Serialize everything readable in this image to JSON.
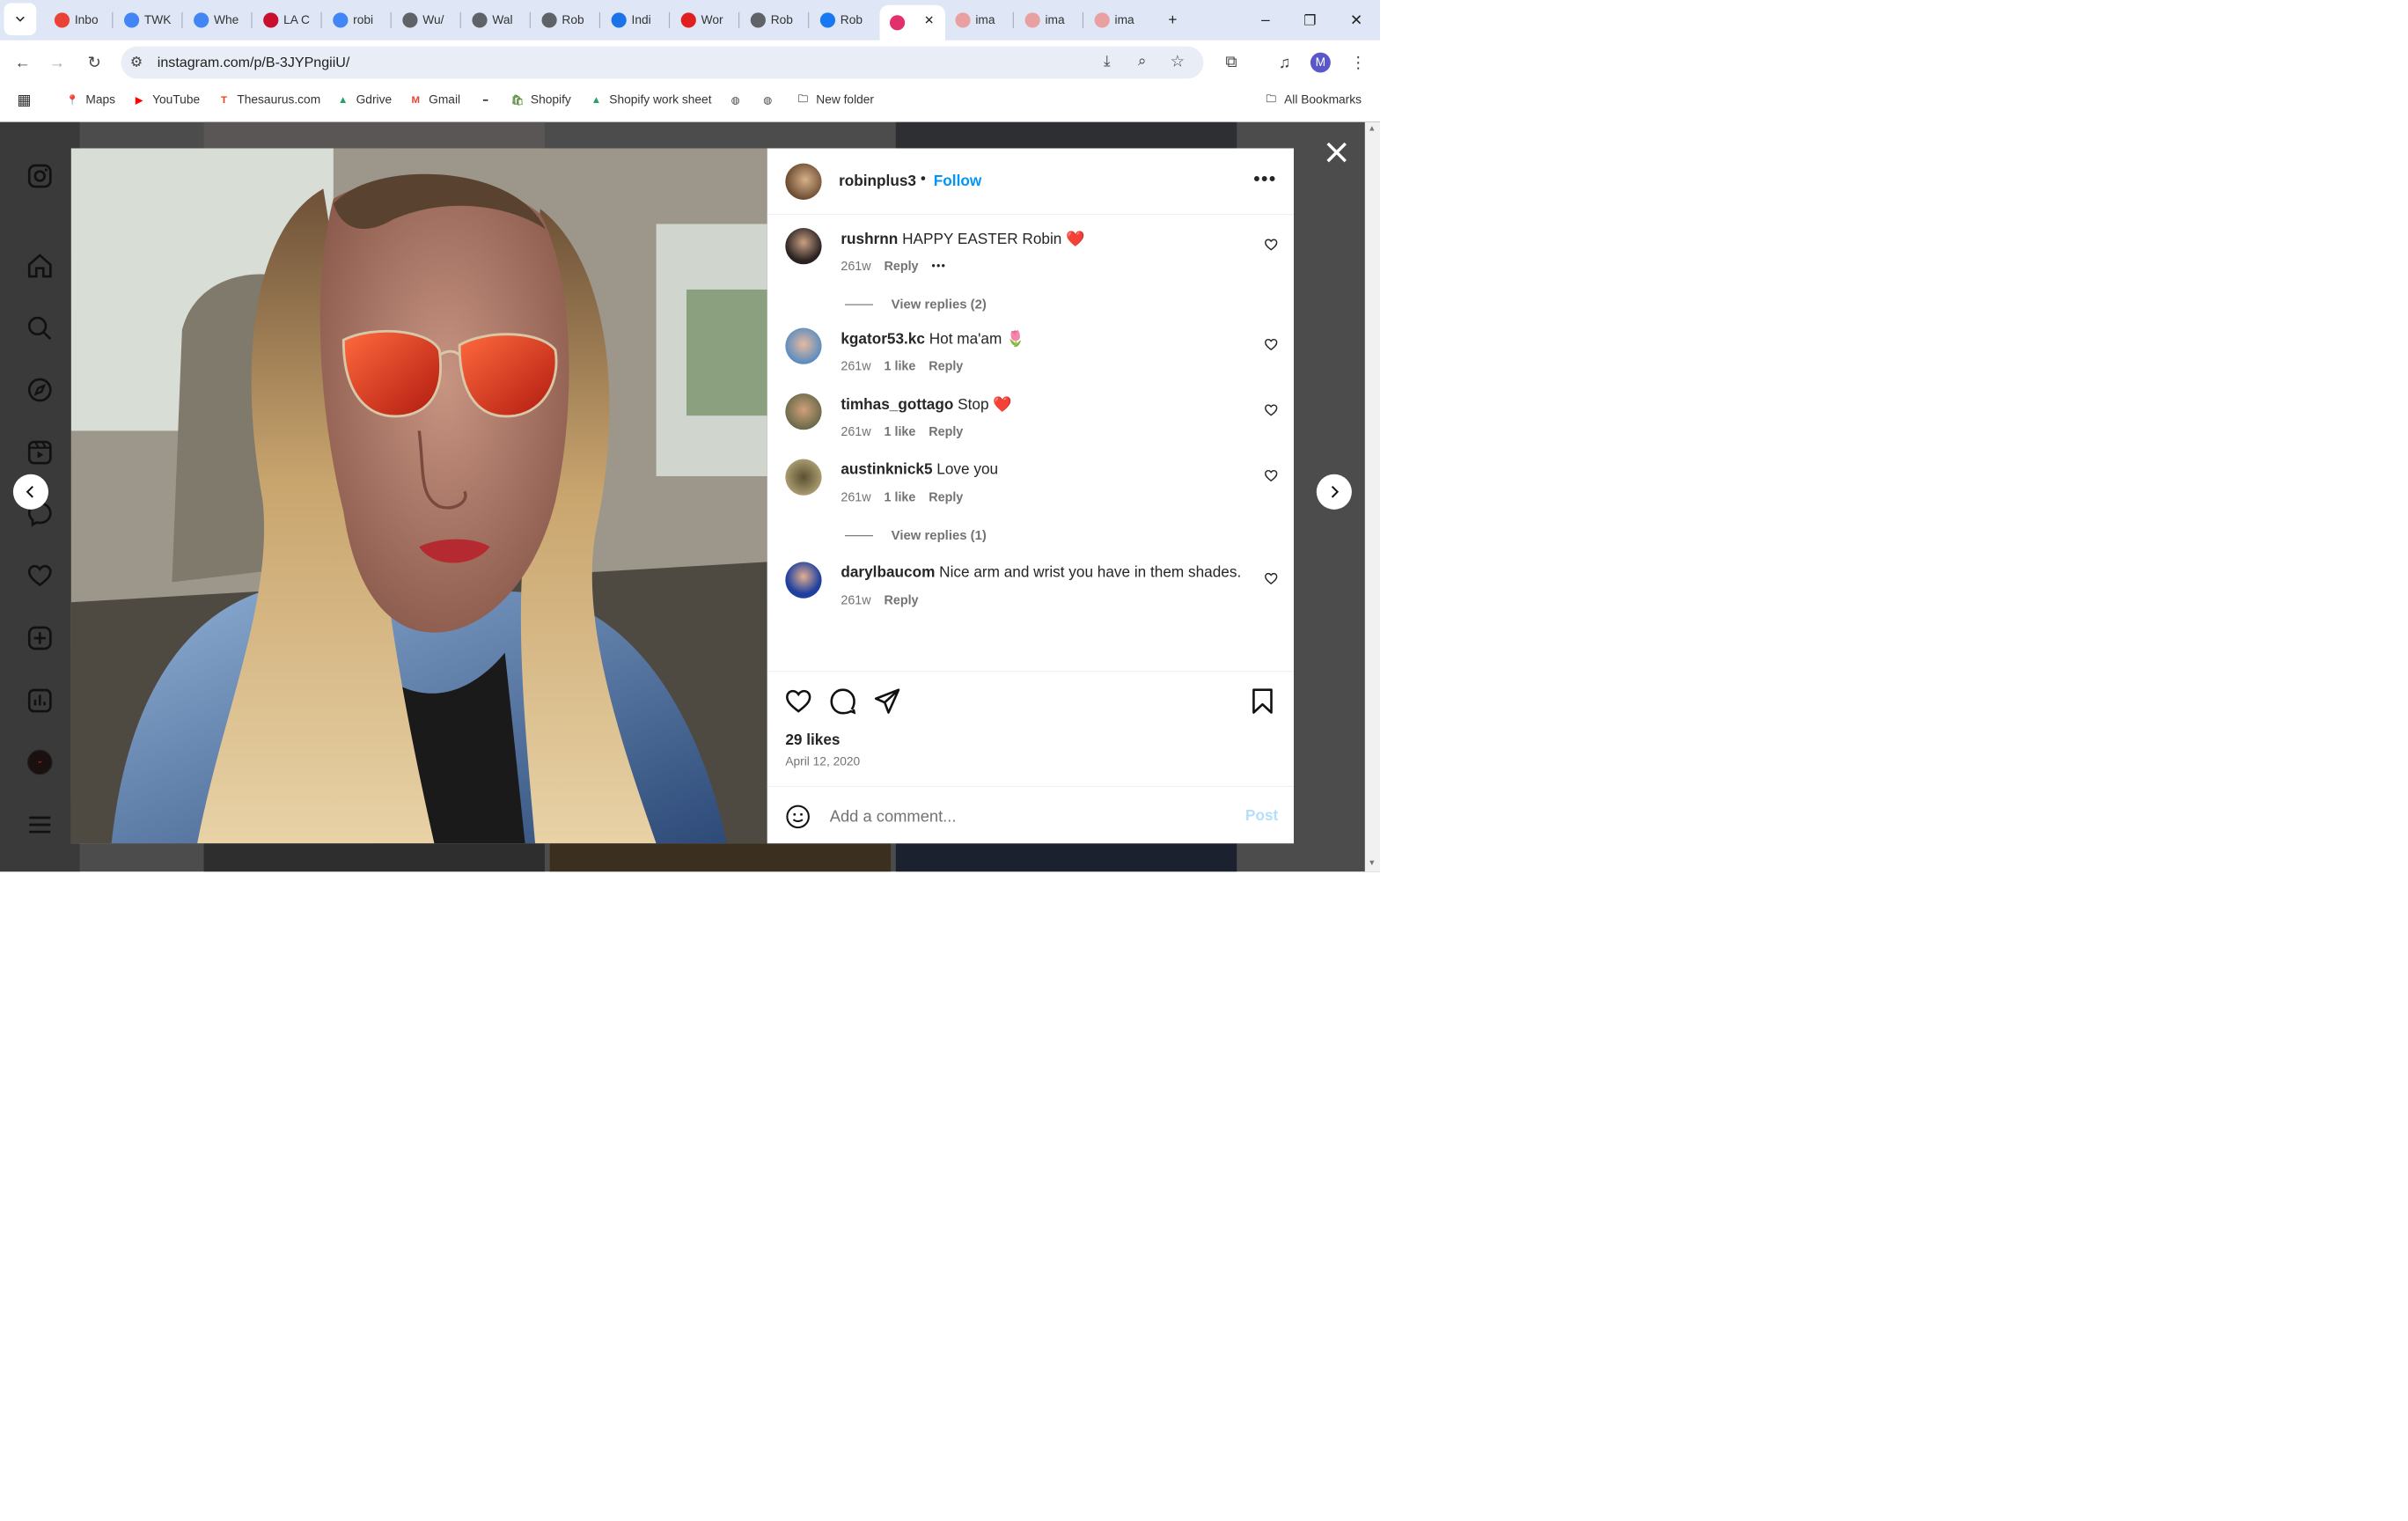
{
  "browser": {
    "tabs": [
      {
        "label": "Inbo",
        "icon": "gmail-icon",
        "color": "#ea4335"
      },
      {
        "label": "TWK",
        "icon": "docs-icon",
        "color": "#4285f4"
      },
      {
        "label": "Whe",
        "icon": "docs-icon",
        "color": "#4285f4"
      },
      {
        "label": "LA C",
        "icon": "nba-icon",
        "color": "#c8102e"
      },
      {
        "label": "robi",
        "icon": "google-icon",
        "color": "#4285f4"
      },
      {
        "label": "Wu/",
        "icon": "globe-icon",
        "color": "#5f6368"
      },
      {
        "label": "Wal",
        "icon": "globe-icon",
        "color": "#5f6368"
      },
      {
        "label": "Rob",
        "icon": "globe-icon",
        "color": "#5f6368"
      },
      {
        "label": "Indi",
        "icon": "search-icon",
        "color": "#1a73e8"
      },
      {
        "label": "Wor",
        "icon": "heart-logo-icon",
        "color": "#e02020"
      },
      {
        "label": "Rob",
        "icon": "globe-icon",
        "color": "#5f6368"
      },
      {
        "label": "Rob",
        "icon": "facebook-icon",
        "color": "#1877f2"
      },
      {
        "label": "",
        "icon": "instagram-icon",
        "color": "#e1306c",
        "active": true
      },
      {
        "label": "ima",
        "icon": "image-icon",
        "color": "#e8a0a0"
      },
      {
        "label": "ima",
        "icon": "image-icon",
        "color": "#e8a0a0"
      },
      {
        "label": "ima",
        "icon": "image-icon",
        "color": "#e8a0a0"
      }
    ],
    "url": "instagram.com/p/B-3JYPngiiU/",
    "profile_initial": "M",
    "bookmarks": [
      {
        "label": "Maps",
        "icon": "maps-icon"
      },
      {
        "label": "YouTube",
        "icon": "youtube-icon"
      },
      {
        "label": "Thesaurus.com",
        "icon": "thesaurus-icon"
      },
      {
        "label": "Gdrive",
        "icon": "gdrive-icon"
      },
      {
        "label": "Gmail",
        "icon": "gmail-icon"
      },
      {
        "label": "",
        "icon": "bbc-icon"
      },
      {
        "label": "Shopify",
        "icon": "shopify-icon"
      },
      {
        "label": "Shopify work sheet",
        "icon": "gdrive-icon"
      },
      {
        "label": "",
        "icon": "globe-icon"
      },
      {
        "label": "",
        "icon": "globe-icon"
      },
      {
        "label": "New folder",
        "icon": "folder-icon"
      }
    ],
    "all_bookmarks": "All Bookmarks"
  },
  "post": {
    "username": "robinplus3",
    "follow": "Follow",
    "likes": "29 likes",
    "date": "April 12, 2020",
    "add_comment_placeholder": "Add a comment...",
    "post_button": "Post"
  },
  "comments": [
    {
      "user": "rushrnn",
      "text": "HAPPY EASTER Robin",
      "emoji": "❤️",
      "time": "261w",
      "likes": "",
      "reply": "Reply",
      "more": "•••",
      "view_replies": "View replies (2)"
    },
    {
      "user": "kgator53.kc",
      "text": "Hot ma'am",
      "emoji": "🌷",
      "time": "261w",
      "likes": "1 like",
      "reply": "Reply",
      "more": "",
      "view_replies": ""
    },
    {
      "user": "timhas_gottago",
      "text": "Stop",
      "emoji": "❤️",
      "time": "261w",
      "likes": "1 like",
      "reply": "Reply",
      "more": "",
      "view_replies": ""
    },
    {
      "user": "austinknick5",
      "text": "Love you",
      "emoji": "",
      "time": "261w",
      "likes": "1 like",
      "reply": "Reply",
      "more": "",
      "view_replies": "View replies (1)"
    },
    {
      "user": "darylbaucom",
      "text": "Nice arm and wrist you have in them shades.",
      "emoji": "",
      "time": "261w",
      "likes": "",
      "reply": "Reply",
      "more": "",
      "view_replies": ""
    }
  ]
}
